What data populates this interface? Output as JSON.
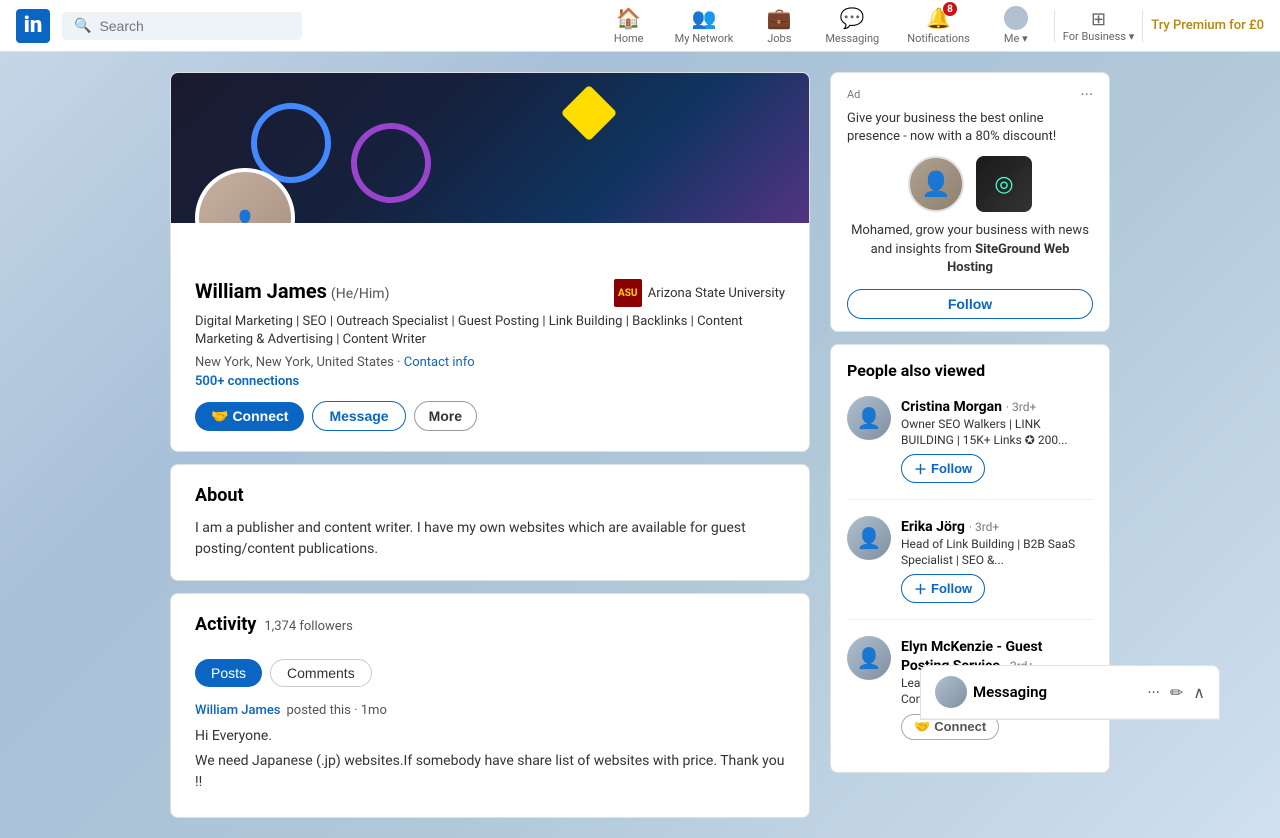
{
  "navbar": {
    "logo_text": "in",
    "search_placeholder": "Search",
    "nav_items": [
      {
        "id": "home",
        "label": "Home",
        "icon": "🏠",
        "badge": null
      },
      {
        "id": "my-network",
        "label": "My Network",
        "icon": "👥",
        "badge": null
      },
      {
        "id": "jobs",
        "label": "Jobs",
        "icon": "💼",
        "badge": null
      },
      {
        "id": "messaging",
        "label": "Messaging",
        "icon": "💬",
        "badge": null
      },
      {
        "id": "notifications",
        "label": "Notifications",
        "icon": "🔔",
        "badge": "8"
      },
      {
        "id": "me",
        "label": "Me ▾",
        "icon": "👤",
        "badge": null
      },
      {
        "id": "for-business",
        "label": "For Business ▾",
        "icon": "⊞",
        "badge": null
      }
    ],
    "try_premium": "Try Premium for £0"
  },
  "profile": {
    "name": "William James",
    "pronoun": "(He/Him)",
    "headline": "Digital Marketing | SEO | Outreach Specialist | Guest Posting | Link Building | Backlinks | Content Marketing & Advertising | Content Writer",
    "location": "New York, New York, United States",
    "contact_info_label": "Contact info",
    "connections": "500+ connections",
    "school_name": "Arizona State University",
    "btn_connect": "Connect",
    "btn_message": "Message",
    "btn_more": "More"
  },
  "about": {
    "title": "About",
    "text": "I am a publisher and content writer. I have my own websites which are available for guest posting/content publications."
  },
  "activity": {
    "title": "Activity",
    "followers": "1,374 followers",
    "tab_posts": "Posts",
    "tab_comments": "Comments",
    "post_author": "William James",
    "post_meta": "posted this · 1mo",
    "post_line1": "Hi Everyone.",
    "post_line2": "We need Japanese (.jp) websites.If somebody have share list of websites with price. Thank you !!"
  },
  "ad": {
    "label": "Ad",
    "tagline": "Give your business the best online presence - now with a 80% discount!",
    "description": "Mohamed, grow your business with news and insights from SiteGround Web Hosting",
    "follow_label": "Follow",
    "brand_icon": "◎"
  },
  "people_also_viewed": {
    "title": "People also viewed",
    "people": [
      {
        "name": "Cristina Morgan",
        "degree": "· 3rd+",
        "headline": "Owner SEO Walkers | LINK BUILDING | 15K+ Links ✪ 200...",
        "action": "Follow",
        "action_type": "follow"
      },
      {
        "name": "Erika Jörg",
        "degree": "· 3rd+",
        "headline": "Head of Link Building | B2B SaaS Specialist | SEO &...",
        "action": "Follow",
        "action_type": "follow"
      },
      {
        "name": "Elyn McKenzie - Guest Posting Service",
        "degree": "· 3rd+",
        "headline": "Lead Generation | SEO Consultant | Content...",
        "action": "Connect",
        "action_type": "connect"
      }
    ]
  },
  "messaging_widget": {
    "title": "Messaging",
    "icons": [
      "···",
      "✏",
      "∧"
    ]
  }
}
